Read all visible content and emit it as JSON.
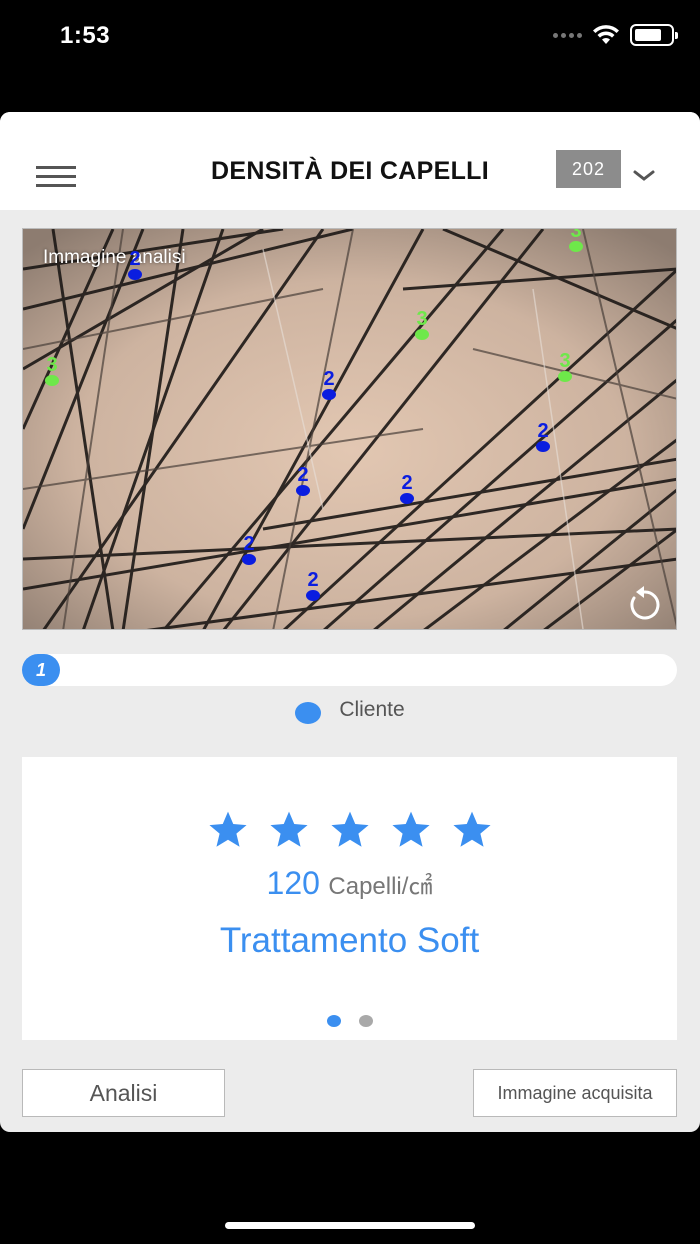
{
  "status_bar": {
    "time": "1:53",
    "icons": [
      "cellular-signal-icon",
      "wifi-icon",
      "battery-icon"
    ]
  },
  "header": {
    "title": "DENSITÀ DEI CAPELLI",
    "badge": "202",
    "menu_icon": "hamburger-menu-icon",
    "chevron_icon": "chevron-down-icon"
  },
  "image": {
    "label": "Immagine analisi",
    "markers": [
      {
        "label": "2",
        "color": "#0a1de0"
      },
      {
        "label": "3",
        "color": "#6ee84a"
      },
      {
        "label": "3",
        "color": "#6ee84a"
      },
      {
        "label": "3",
        "color": "#6ee84a"
      },
      {
        "label": "3",
        "color": "#6ee84a"
      },
      {
        "label": "2",
        "color": "#0a1de0"
      },
      {
        "label": "2",
        "color": "#0a1de0"
      },
      {
        "label": "2",
        "color": "#0a1de0"
      },
      {
        "label": "2",
        "color": "#0a1de0"
      },
      {
        "label": "2",
        "color": "#0a1de0"
      },
      {
        "label": "2",
        "color": "#0a1de0"
      }
    ],
    "reset_icon": "rotate-reset-icon"
  },
  "progress": {
    "knob_label": "1",
    "legend_label": "Cliente"
  },
  "result": {
    "stars": 5,
    "star_color": "#3b8ff0",
    "density_value": "120",
    "density_unit": "Capelli/㎠",
    "treatment": "Trattamento Soft",
    "pages": 2,
    "active_page": 1
  },
  "buttons": {
    "analysis": "Analisi",
    "acquired_image": "Immagine acquisita"
  },
  "colors": {
    "accent": "#3b8ff0",
    "badge_bg": "#8c8c8c"
  }
}
